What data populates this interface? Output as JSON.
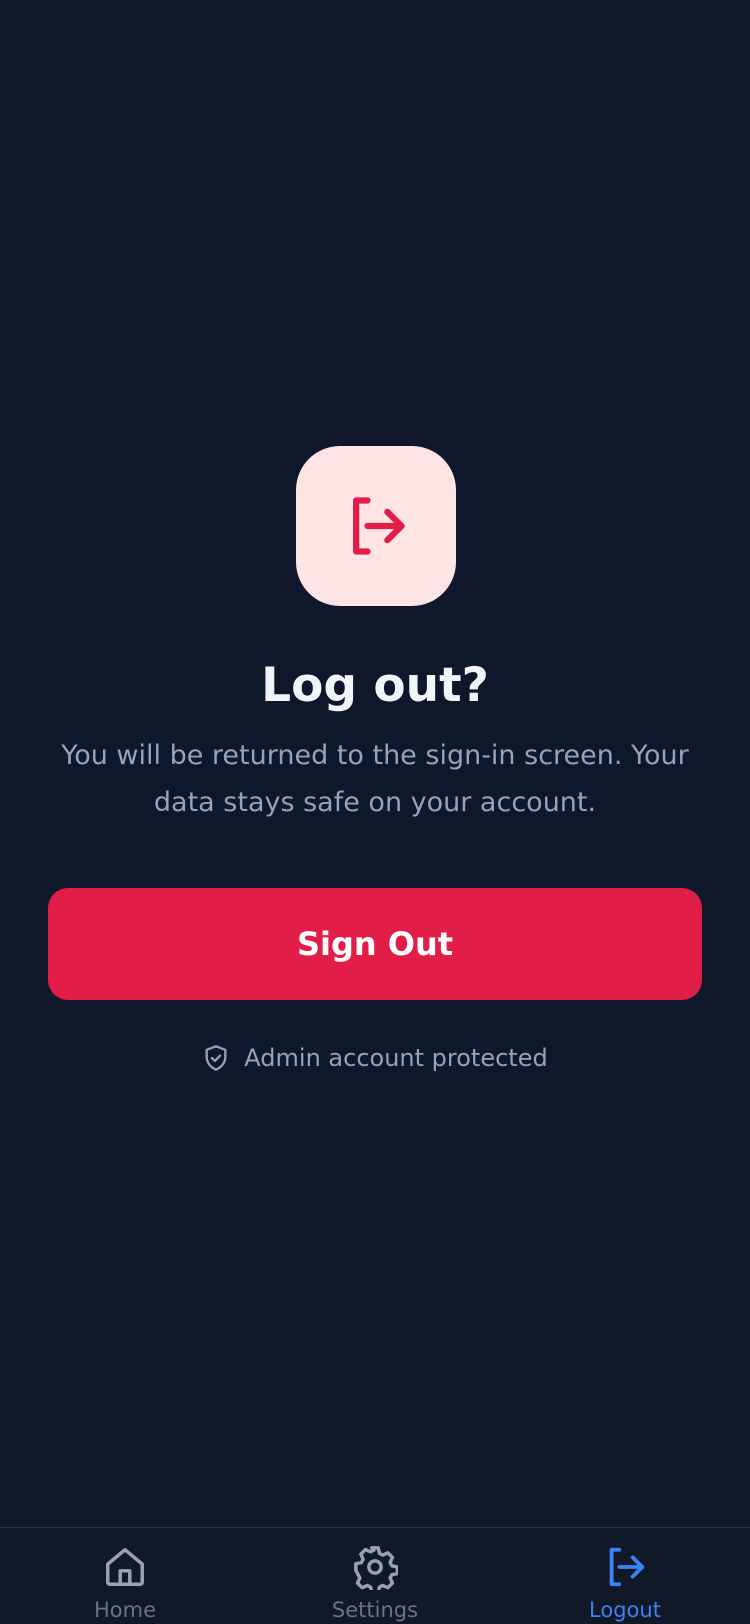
{
  "dialog": {
    "title": "Log out?",
    "message": "You will be returned to the sign-in screen. Your data stays safe on your account.",
    "primary_button": "Sign Out",
    "footnote": "Admin account protected",
    "icon": "logout-icon",
    "icon_color": "#e11d48",
    "icon_bg": "#ffe4e6"
  },
  "tabbar": {
    "tabs": [
      {
        "label": "Home",
        "icon": "home-icon",
        "active": false
      },
      {
        "label": "Settings",
        "icon": "gear-icon",
        "active": false
      },
      {
        "label": "Logout",
        "icon": "logout-icon",
        "active": true
      }
    ],
    "active_color": "#3b82f6",
    "inactive_color": "#64748b"
  },
  "colors": {
    "background": "#0f172a",
    "danger": "#e11d48",
    "muted_text": "#94a3b8"
  }
}
